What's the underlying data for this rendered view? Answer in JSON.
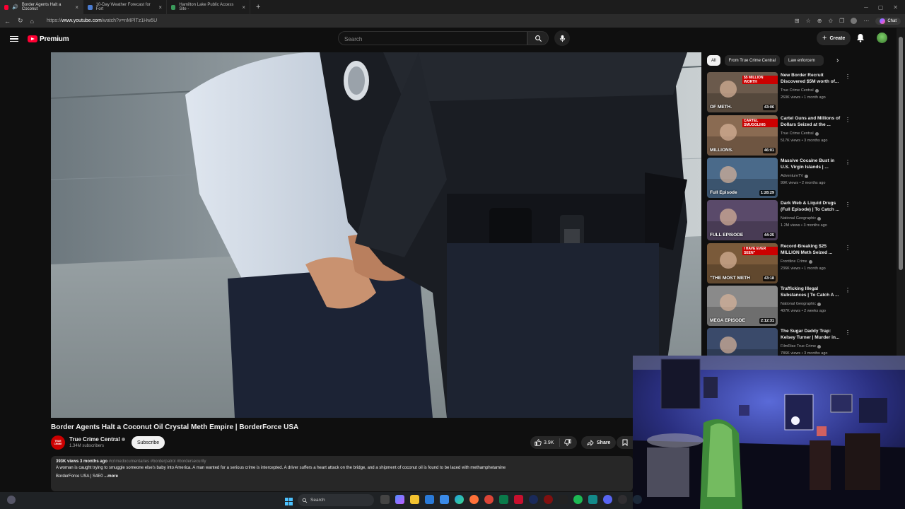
{
  "browser": {
    "tabs": [
      {
        "label": "Border Agents Halt a Coconut",
        "active": true
      },
      {
        "label": "10-Day Weather Forecast for Fort",
        "active": false
      },
      {
        "label": "Hamilton Lake Public Access Site -",
        "active": false
      }
    ],
    "url_prefix": "https://",
    "url_host": "www.youtube.com",
    "url_path": "/watch?v=nMPlTz1Hw5U",
    "chat_label": "Chat"
  },
  "youtube": {
    "logo_text": "Premium",
    "search_placeholder": "Search",
    "create_label": "Create"
  },
  "video": {
    "title": "Border Agents Halt a Coconut Oil Crystal Meth Empire | BorderForce USA",
    "channel": "True Crime Central",
    "channel_avatar_text": "TRUE CRIME",
    "subscribers": "1.34M subscribers",
    "subscribe_label": "Subscribe",
    "likes": "3.9K",
    "share_label": "Share",
    "views": "393K views",
    "age": "3 months ago",
    "tags": "#crimedocumentaries #borderpatrol #bordersecurity",
    "description": "A woman is caught trying to smuggle someone else's baby into America. A man wanted for a serious crime is intercepted. A driver suffers a heart attack on the bridge, and a shipment of coconut oil is found to be laced with methamphetamine",
    "description_line2": "BorderForce USA | S4E0",
    "more_label": "...more"
  },
  "sidebar": {
    "chips": [
      "All",
      "From True Crime Central",
      "Law enforcem"
    ],
    "recommendations": [
      {
        "title": "New Border Recruit Discovered $5M worth of...",
        "channel": "True Crime Central",
        "meta": "260K views • 1 month ago",
        "duration": "43:06",
        "thumb_text": "OF METH.",
        "thumb_text2": "$5 MILLION WORTH",
        "thumb_color": "#6b5a4c"
      },
      {
        "title": "Cartel Guns and Millions of Dollars Seized at the ...",
        "channel": "True Crime Central",
        "meta": "517K views • 3 months ago",
        "duration": "46:01",
        "thumb_text": "MILLIONS.",
        "thumb_text2": "CARTEL SMUGGLING",
        "thumb_color": "#8a6b52"
      },
      {
        "title": "Massive Cocaine Bust in U.S. Virgin Islands | ...",
        "channel": "AdventureTV",
        "meta": "99K views • 2 months ago",
        "duration": "1:28:29",
        "thumb_text": "Full Episode",
        "thumb_text2": "",
        "thumb_color": "#4a6a8a"
      },
      {
        "title": "Dark Web & Liquid Drugs (Full Episode) | To Catch ...",
        "channel": "National Geographic",
        "meta": "1.2M views • 3 months ago",
        "duration": "44:25",
        "thumb_text": "FULL EPISODE",
        "thumb_text2": "",
        "thumb_color": "#5a4a6a"
      },
      {
        "title": "Record-Breaking $25 MILLION Meth Seized ...",
        "channel": "Frontline Crime",
        "meta": "236K views • 1 month ago",
        "duration": "43:18",
        "thumb_text": "\"THE MOST METH",
        "thumb_text2": "I HAVE EVER SEEN\"",
        "thumb_color": "#7a5a3a"
      },
      {
        "title": "Trafficking Illegal Substances | To Catch A ...",
        "channel": "National Geographic",
        "meta": "407K views • 2 weeks ago",
        "duration": "2:12:31",
        "thumb_text": "MEGA EPISODE",
        "thumb_text2": "",
        "thumb_color": "#8a8a8a"
      },
      {
        "title": "The Sugar Daddy Trap: Kelsey Turner | Murder in...",
        "channel": "FilmRise True Crime",
        "meta": "786K views • 3 months ago",
        "duration": "",
        "thumb_text": "",
        "thumb_text2": "",
        "thumb_color": "#3a4a6a"
      }
    ]
  },
  "taskbar": {
    "search_label": "Search"
  },
  "colors": {
    "yt_red": "#ff0033",
    "bg": "#0f0f0f",
    "chip_bg": "#272727"
  }
}
